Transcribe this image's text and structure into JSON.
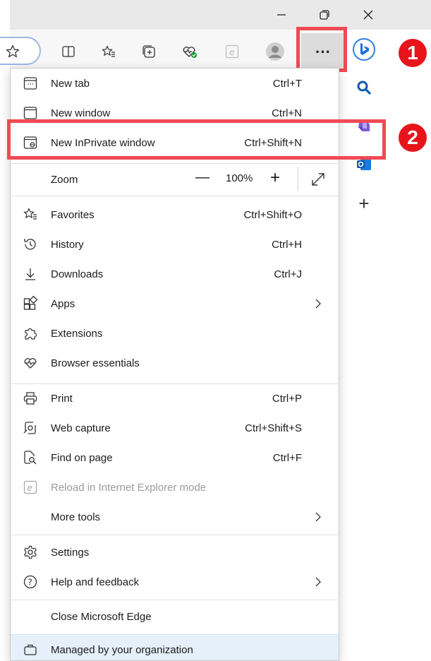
{
  "window": {
    "minimize_icon": "minimize-icon",
    "restore_icon": "restore-icon",
    "close_icon": "close-icon"
  },
  "toolbar": {
    "buttons": [
      "favorite-star-icon",
      "split-screen-icon",
      "favorites-icon",
      "collections-icon",
      "browser-essentials-icon",
      "ie-mode-icon",
      "profile-icon"
    ],
    "more_label": "···"
  },
  "menu": {
    "new_tab": {
      "label": "New tab",
      "shortcut": "Ctrl+T"
    },
    "new_window": {
      "label": "New window",
      "shortcut": "Ctrl+N"
    },
    "new_inprivate": {
      "label": "New InPrivate window",
      "shortcut": "Ctrl+Shift+N"
    },
    "zoom": {
      "label": "Zoom",
      "value": "100%",
      "minus": "—",
      "plus": "+"
    },
    "favorites": {
      "label": "Favorites",
      "shortcut": "Ctrl+Shift+O"
    },
    "history": {
      "label": "History",
      "shortcut": "Ctrl+H"
    },
    "downloads": {
      "label": "Downloads",
      "shortcut": "Ctrl+J"
    },
    "apps": {
      "label": "Apps"
    },
    "extensions": {
      "label": "Extensions"
    },
    "browser_essentials": {
      "label": "Browser essentials"
    },
    "print": {
      "label": "Print",
      "shortcut": "Ctrl+P"
    },
    "web_capture": {
      "label": "Web capture",
      "shortcut": "Ctrl+Shift+S"
    },
    "find_on_page": {
      "label": "Find on page",
      "shortcut": "Ctrl+F"
    },
    "reload_ie": {
      "label": "Reload in Internet Explorer mode"
    },
    "more_tools": {
      "label": "More tools"
    },
    "settings": {
      "label": "Settings"
    },
    "help": {
      "label": "Help and feedback"
    },
    "close_edge": {
      "label": "Close Microsoft Edge"
    },
    "managed": {
      "label": "Managed by your organization"
    }
  },
  "sidebar": {
    "items": [
      "bing-icon",
      "search-icon",
      "copilot-icon",
      "outlook-icon",
      "add-icon"
    ],
    "add_label": "+"
  },
  "annotations": {
    "badge1": "1",
    "badge2": "2"
  },
  "colors": {
    "highlight": "#f04a55",
    "badge": "#e8141b",
    "managed_bg": "#e6f0fa"
  }
}
